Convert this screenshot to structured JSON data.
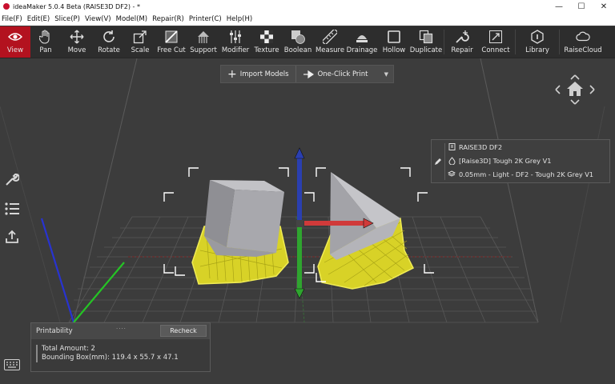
{
  "window": {
    "title": "ideaMaker 5.0.4 Beta (RAISE3D DF2) - *",
    "controls": [
      "—",
      "☐",
      "✕"
    ]
  },
  "menu": [
    "File(F)",
    "Edit(E)",
    "Slice(P)",
    "View(V)",
    "Model(M)",
    "Repair(R)",
    "Printer(C)",
    "Help(H)"
  ],
  "toolbar": {
    "tools": [
      {
        "label": "View",
        "icon": "eye-icon",
        "active": true
      },
      {
        "label": "Pan",
        "icon": "hand-icon"
      },
      {
        "label": "Move",
        "icon": "move-icon"
      },
      {
        "label": "Rotate",
        "icon": "rotate-icon"
      },
      {
        "label": "Scale",
        "icon": "scale-icon"
      },
      {
        "label": "Free Cut",
        "icon": "cut-icon"
      },
      {
        "label": "Support",
        "icon": "support-icon"
      },
      {
        "label": "Modifier",
        "icon": "modifier-icon"
      },
      {
        "label": "Texture",
        "icon": "texture-icon"
      },
      {
        "label": "Boolean",
        "icon": "boolean-icon"
      },
      {
        "label": "Measure",
        "icon": "ruler-icon"
      },
      {
        "label": "Drainage",
        "icon": "drainage-icon"
      },
      {
        "label": "Hollow",
        "icon": "hollow-icon"
      },
      {
        "label": "Duplicate",
        "icon": "duplicate-icon"
      },
      {
        "label": "Repair",
        "icon": "wrench-plus-icon"
      },
      {
        "label": "Connect",
        "icon": "connect-icon"
      },
      {
        "label": "Library",
        "icon": "library-icon"
      },
      {
        "label": "RaiseCloud",
        "icon": "cloud-icon"
      }
    ]
  },
  "actionbar": {
    "import_label": "Import Models",
    "print_label": "One-Click Print",
    "dropdown": "▼"
  },
  "printer_info": {
    "printer": "RAISE3D DF2",
    "material": "[Raise3D] Tough 2K Grey V1",
    "profile": "0.05mm - Light - DF2 - Tough 2K Grey V1"
  },
  "printability": {
    "title": "Printability",
    "grip": "....",
    "recheck_label": "Recheck",
    "total_amount": "Total Amount: 2",
    "bounding_box": "Bounding Box(mm): 119.4 x 55.7 x 47.1"
  },
  "colors": {
    "accent": "#b3121f",
    "support": "#e6e02a",
    "model": "#a9a9ad",
    "axis_x": "#d03a3a",
    "axis_y": "#2fa52f",
    "axis_z": "#2a3fb0"
  }
}
